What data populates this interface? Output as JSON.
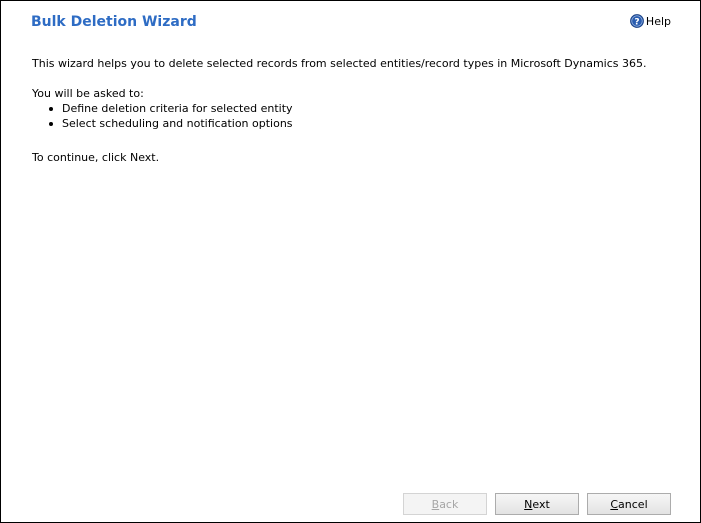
{
  "wizard": {
    "title": "Bulk Deletion Wizard",
    "help_label": "Help",
    "help_icon": "question-circle-icon",
    "intro_text": "This wizard helps you to delete selected records from selected entities/record types in Microsoft Dynamics 365.",
    "asked_text": "You will be asked to:",
    "steps": [
      "Define deletion criteria for selected entity",
      "Select scheduling and notification options"
    ],
    "continue_text": "To continue, click Next."
  },
  "buttons": {
    "back": {
      "accel": "B",
      "rest": "ack",
      "enabled": false
    },
    "next": {
      "accel": "N",
      "rest": "ext",
      "enabled": true
    },
    "cancel": {
      "accel": "C",
      "rest": "ancel",
      "enabled": true
    }
  },
  "colors": {
    "title": "#2e6cc4",
    "help_icon": "#2a5db0"
  }
}
